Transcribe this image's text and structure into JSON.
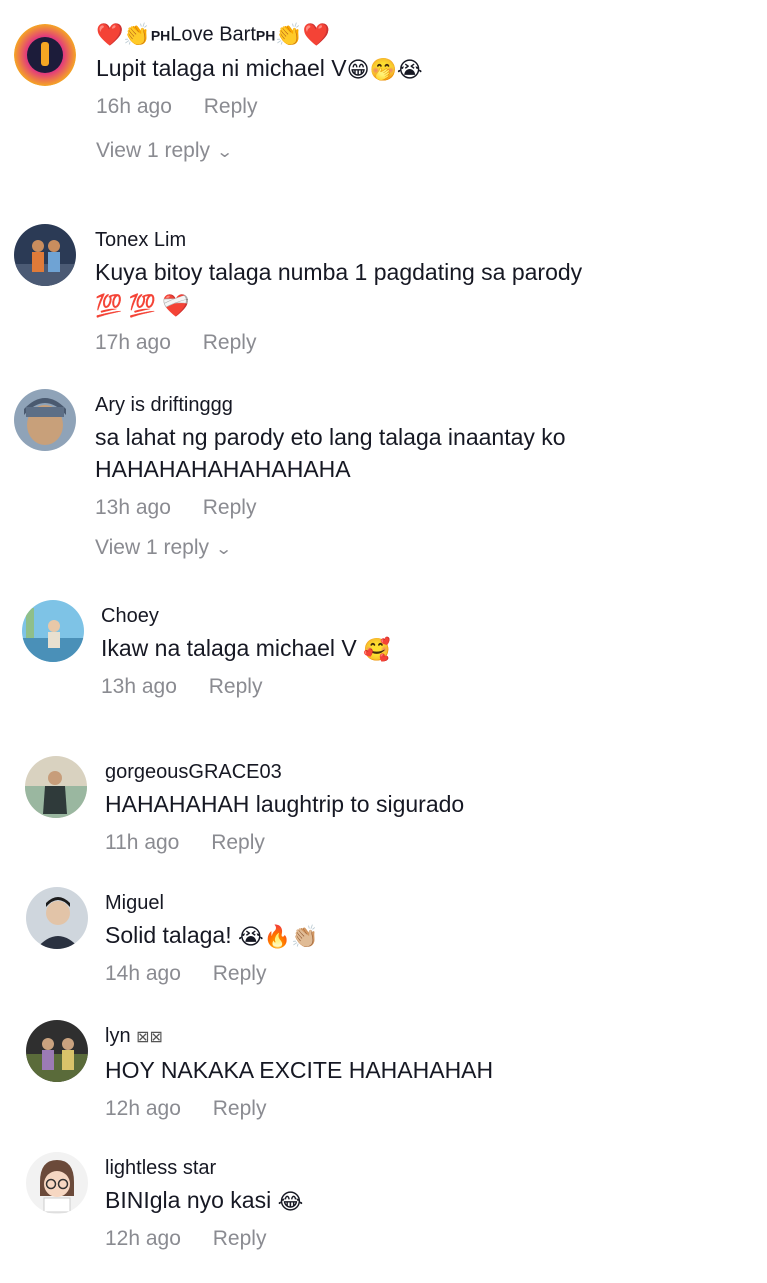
{
  "comments": [
    {
      "username_parts": [
        "❤️",
        "👏",
        "PH",
        "Love Bart",
        "PH",
        "👏",
        "❤️"
      ],
      "text": "Lupit talaga ni michael V",
      "text_emoji": "😁🤭😭",
      "time": "16h ago",
      "reply_label": "Reply",
      "view_replies": "View 1 reply",
      "avatar_colors": [
        "#e23b7c",
        "#f5a623",
        "#3a2a6c"
      ]
    },
    {
      "username": "Tonex Lim",
      "text": "Kuya bitoy talaga numba 1 pagdating sa parody",
      "text_emoji": "💯 💯  ❤️‍🩹",
      "time": "17h ago",
      "reply_label": "Reply",
      "avatar_colors": [
        "#2b3a55",
        "#c98d5e",
        "#6fa3d4"
      ]
    },
    {
      "username": "Ary is driftinggg",
      "text": "sa lahat ng parody eto lang talaga inaantay ko HAHAHAHAHAHAHAHA",
      "time": "13h ago",
      "reply_label": "Reply",
      "view_replies": "View 1 reply",
      "avatar_colors": [
        "#8fa3b8",
        "#c8a07a",
        "#4a5a70"
      ]
    },
    {
      "username": "Choey",
      "text": "Ikaw na talaga michael V",
      "text_emoji": "🥰",
      "time": "13h ago",
      "reply_label": "Reply",
      "avatar_colors": [
        "#7ec3e6",
        "#e8e0d0",
        "#4a90b8"
      ]
    },
    {
      "username": "gorgeousGRACE03",
      "text": "HAHAHAHAH laughtrip to sigurado",
      "time": "11h ago",
      "reply_label": "Reply",
      "avatar_colors": [
        "#9ab7a0",
        "#d9d2c0",
        "#2f3a3a"
      ]
    },
    {
      "username": "Miguel",
      "text": "Solid talaga!",
      "text_emoji": "😭🔥👏🏼",
      "time": "14h ago",
      "reply_label": "Reply",
      "avatar_colors": [
        "#cfd6dd",
        "#2a3140",
        "#e2c4a8"
      ]
    },
    {
      "username": "lyn",
      "username_suffix": "⊠⊠",
      "text": "HOY NAKAKA EXCITE HAHAHAHAH",
      "time": "12h ago",
      "reply_label": "Reply",
      "avatar_colors": [
        "#5a6b3a",
        "#9c7bb5",
        "#2f2f2f"
      ]
    },
    {
      "username": "lightless star",
      "text": "BINIgla nyo kasi",
      "text_emoji": "😂",
      "time": "12h ago",
      "reply_label": "Reply",
      "avatar_colors": [
        "#f2f2f2",
        "#6b4a3a",
        "#f6d7c2"
      ]
    }
  ]
}
